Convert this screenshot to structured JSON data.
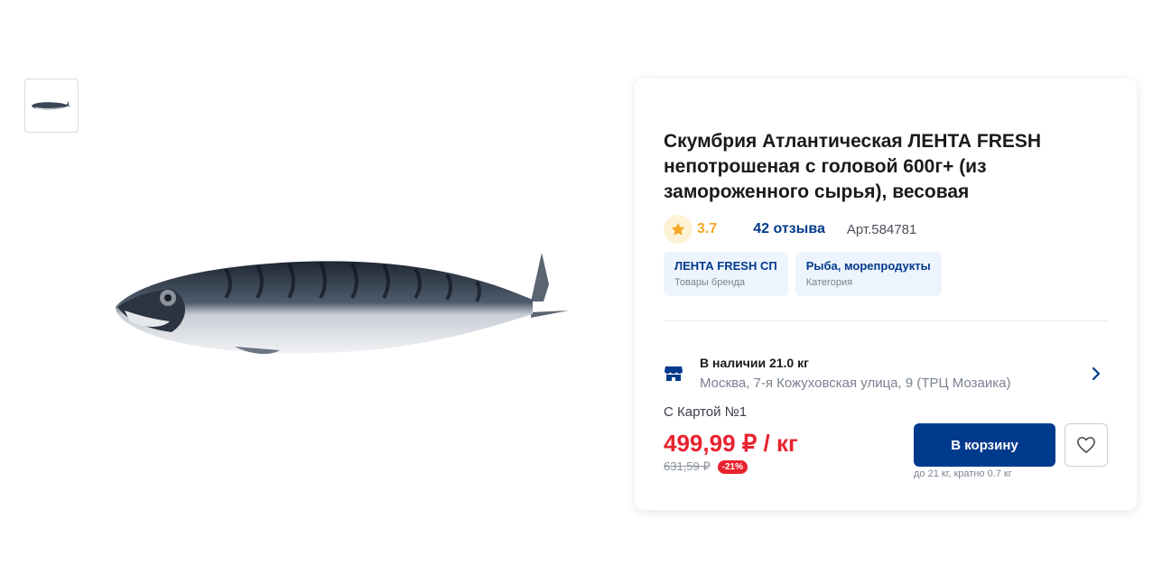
{
  "gallery": {
    "thumbnail_icon": "mackerel-thumbnail-image",
    "main_image_icon": "mackerel-fish-image"
  },
  "product": {
    "title": "Скумбрия Атлантическая ЛЕНТА FRESH непотрошеная с головой 600г+ (из замороженного сырья), весовая",
    "rating": "3.7",
    "rating_icon": "star-icon",
    "reviews_label": "42 отзыва",
    "article": "Арт.584781",
    "chips": [
      {
        "title": "ЛЕНТА FRESH СП",
        "subtitle": "Товары бренда"
      },
      {
        "title": "Рыба, морепродукты",
        "subtitle": "Категория"
      }
    ]
  },
  "stock": {
    "icon": "store-icon",
    "title": "В наличии 21.0 кг",
    "address": "Москва, 7-я Кожуховская улица, 9 (ТРЦ Мозаика)"
  },
  "pricing": {
    "card_label": "С Картой №1",
    "price": "499,99 ₽ / кг",
    "old_price": "631,59 ₽",
    "discount": "-21%",
    "cart_button": "В корзину",
    "cart_note": "до 21 кг, кратно 0.7 кг"
  },
  "colors": {
    "brand": "#003a8c",
    "price_red": "#e8232f",
    "rating_star": "#f5a623",
    "chip_bg": "#eef4fd"
  }
}
